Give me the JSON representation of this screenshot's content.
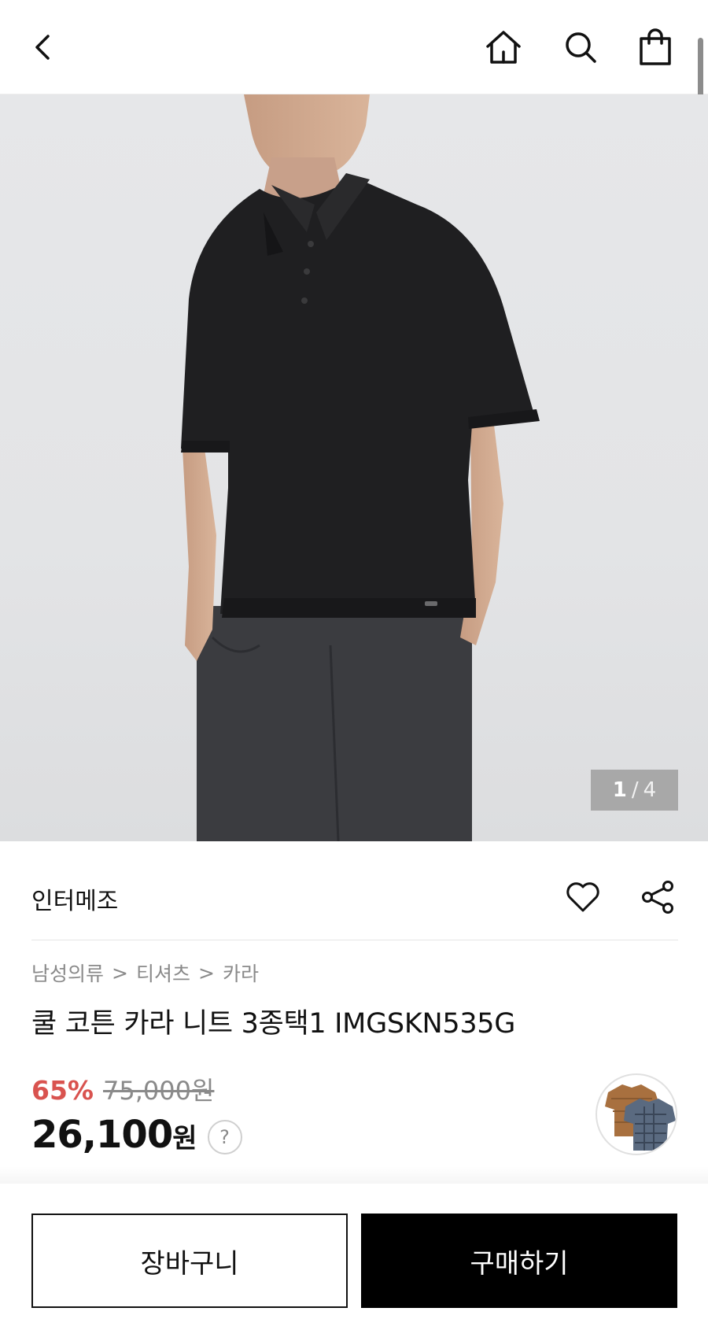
{
  "header": {
    "icons": [
      "chevron-left-icon",
      "home-icon",
      "search-icon",
      "shopping-bag-icon"
    ]
  },
  "gallery": {
    "current": "1",
    "separator": "/",
    "total": "4"
  },
  "product": {
    "brand": "인터메조",
    "breadcrumb": [
      "남성의류",
      "티셔츠",
      "카라"
    ],
    "breadcrumb_separator": ">",
    "title": "쿨 코튼 카라 니트 3종택1 IMGSKN535G",
    "discount": "65%",
    "original_price": "75,000원",
    "sale_price_number": "26,100",
    "sale_price_unit": "원",
    "help_symbol": "?"
  },
  "actions": {
    "cart_label": "장바구니",
    "buy_label": "구매하기"
  },
  "colors": {
    "discount": "#d9534f",
    "primary_button_bg": "#000000",
    "primary_button_text": "#ffffff"
  }
}
